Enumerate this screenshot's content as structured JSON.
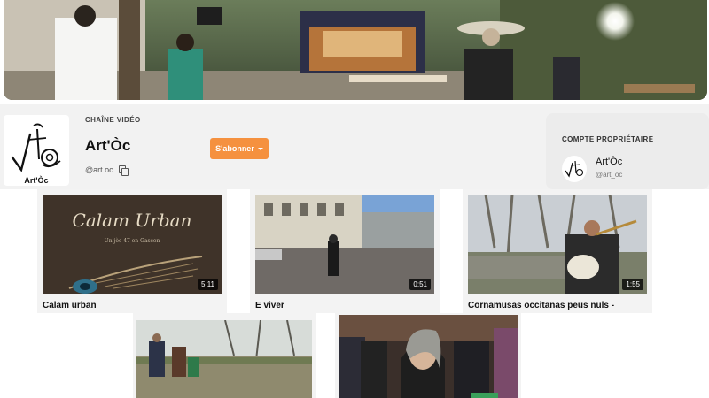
{
  "channel": {
    "kicker": "CHAÎNE VIDÉO",
    "name": "Art'Òc",
    "handle": "@art.oc",
    "logo_text": "Art'Òc",
    "subscribe_label": "S'abonner"
  },
  "owner": {
    "label": "COMPTE PROPRIÉTAIRE",
    "name": "Art'Òc",
    "handle": "@art_oc"
  },
  "videos": [
    {
      "title": "Calam urban",
      "duration": "5:11",
      "thumb_title": "Calam Urban",
      "thumb_subtitle": "Un jòc 47 en Gascon"
    },
    {
      "title": "E viver",
      "duration": "0:51"
    },
    {
      "title": "Cornamusas occitanas peus nuls -",
      "duration": "1:55"
    },
    {
      "title": "",
      "duration": ""
    },
    {
      "title": "",
      "duration": ""
    }
  ],
  "colors": {
    "accent": "#f5913f",
    "page_bg": "#ffffff",
    "strip_bg": "#f2f2f2"
  },
  "icons": [
    "copy-icon",
    "chevron-down-icon"
  ]
}
